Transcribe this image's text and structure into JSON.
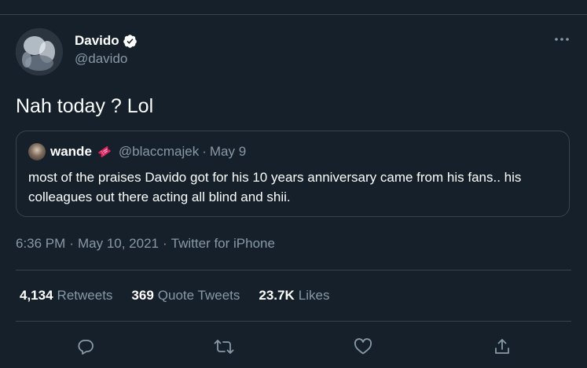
{
  "tweet": {
    "author": {
      "display_name": "Davido",
      "handle": "@davido",
      "verified": true,
      "avatar_icon": "profile-photo"
    },
    "text": "Nah today ? Lol",
    "quoted_tweet": {
      "author_name": "wande",
      "author_emoji_icon": "ticket-icon",
      "handle": "@blaccmajek",
      "separator": "·",
      "date": "May 9",
      "text": "most of the praises Davido got for his 10 years anniversary came from his fans.. his colleagues out there acting all blind and shii."
    },
    "meta": {
      "time": "6:36 PM",
      "separator": "·",
      "date": "May 10, 2021",
      "source": "Twitter for iPhone"
    },
    "stats": {
      "retweets_count": "4,134",
      "retweets_label": "Retweets",
      "quote_tweets_count": "369",
      "quote_tweets_label": "Quote Tweets",
      "likes_count": "23.7K",
      "likes_label": "Likes"
    },
    "actions": [
      "reply-icon",
      "retweet-icon",
      "like-icon",
      "share-icon"
    ],
    "more_icon": "more-horizontal-icon"
  },
  "colors": {
    "background": "#15202b",
    "border": "#38444d",
    "secondary_text": "#8899a6",
    "primary_text": "#ffffff",
    "verified_badge": "#ffffff",
    "ticket": "#e0245e"
  }
}
